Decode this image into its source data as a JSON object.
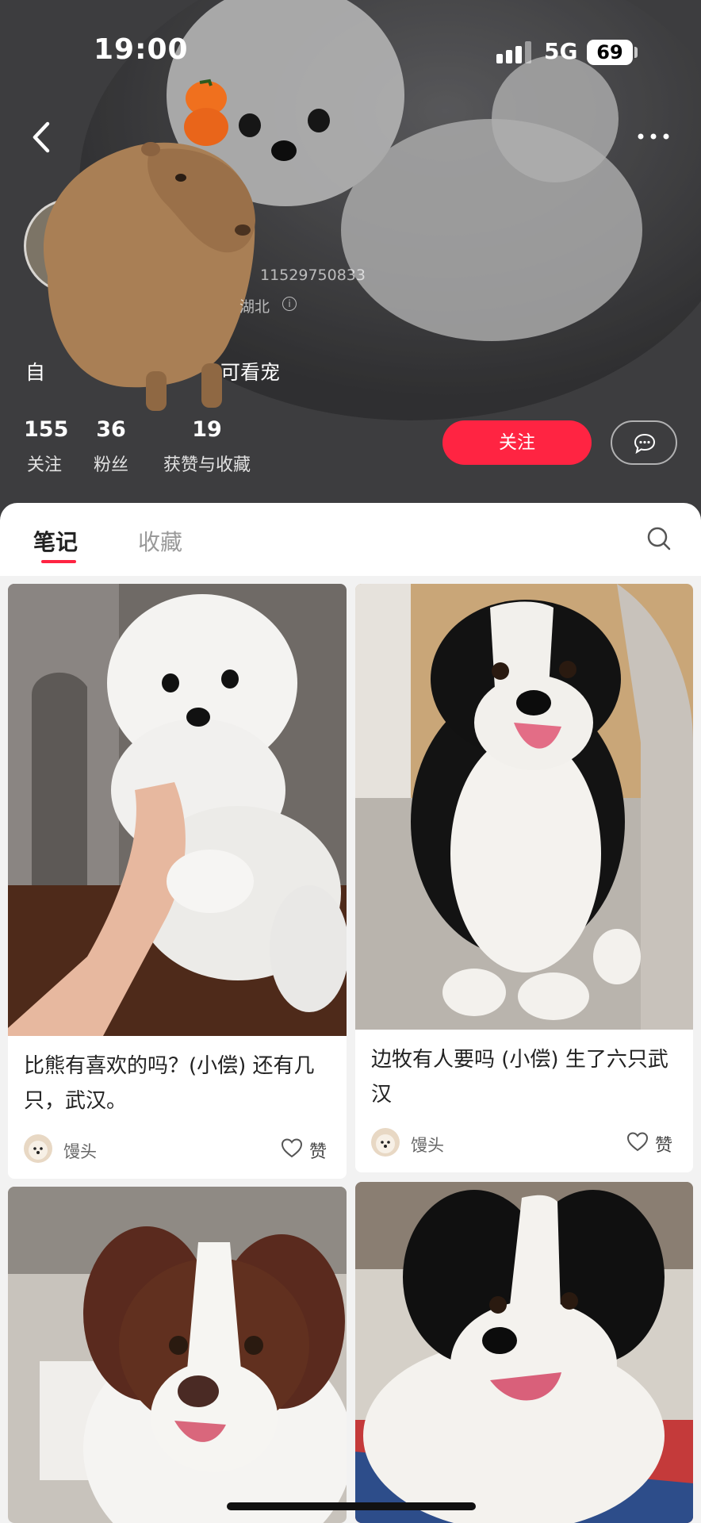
{
  "status_bar": {
    "time": "19:00",
    "network": "5G",
    "battery": "69"
  },
  "profile": {
    "user_id": "11529750833",
    "location": "湖北",
    "bio_prefix": "自",
    "bio_suffix": "可看宠",
    "stats": [
      {
        "value": "155",
        "label": "关注"
      },
      {
        "value": "36",
        "label": "粉丝"
      },
      {
        "value": "19",
        "label": "获赞与收藏"
      }
    ],
    "follow_label": "关注"
  },
  "tabs": {
    "notes": "笔记",
    "favorites": "收藏"
  },
  "feed": [
    {
      "title": "比熊有喜欢的吗？(小偿) 还有几只，武汉。",
      "author": "馒头",
      "like_label": "赞"
    },
    {
      "title": "边牧有人要吗 (小偿) 生了六只武汉",
      "author": "馒头",
      "like_label": "赞"
    }
  ],
  "colors": {
    "accent": "#ff2442",
    "header_bg": "#4a4a4c"
  },
  "icons": [
    "back-icon",
    "more-icon",
    "chat-icon",
    "search-icon",
    "heart-icon",
    "info-icon"
  ]
}
